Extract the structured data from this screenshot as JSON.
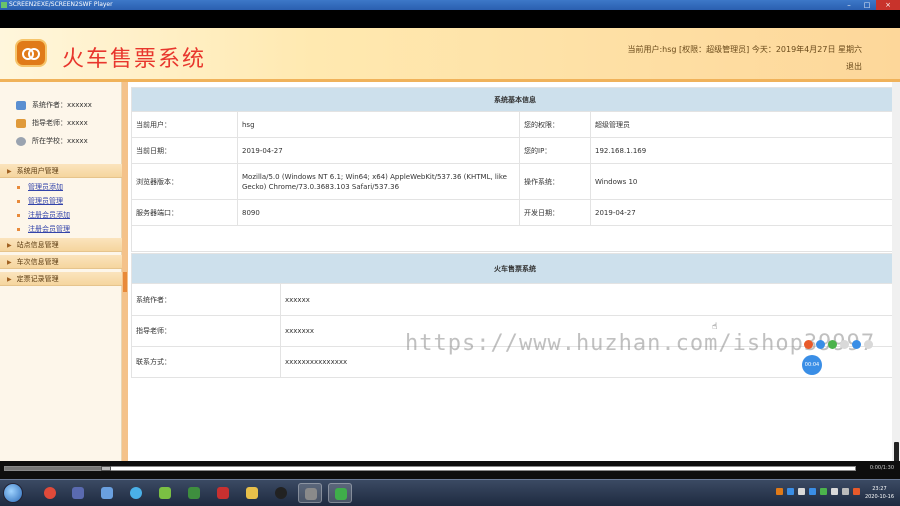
{
  "window": {
    "title": "SCREEN2EXE/SCREEN2SWF Player"
  },
  "header": {
    "system_title": "火车售票系统",
    "user_info": "当前用户:hsg [权限：超级管理员] 今天：2019年4月27日 星期六",
    "logout": "退出"
  },
  "sidebar": {
    "info": [
      {
        "label": "系统作者：xxxxxx"
      },
      {
        "label": "指导老师：xxxxx"
      },
      {
        "label": "所在学校：xxxxx"
      }
    ],
    "groups": [
      {
        "label": "系统用户管理",
        "items": [
          "管理员添加",
          "管理员管理",
          "注册会员添加",
          "注册会员管理"
        ]
      },
      {
        "label": "站点信息管理"
      },
      {
        "label": "车次信息管理"
      },
      {
        "label": "定票记录管理"
      }
    ]
  },
  "basic_info": {
    "header": "系统基本信息",
    "rows": [
      {
        "k1": "当前用户：",
        "v1": "hsg",
        "k2": "您的权限：",
        "v2": "超级管理员"
      },
      {
        "k1": "当前日期：",
        "v1": "2019-04-27",
        "k2": "您的IP：",
        "v2": "192.168.1.169"
      },
      {
        "k1": "浏览器版本：",
        "v1": "Mozilla/5.0 (Windows NT 6.1; Win64; x64) AppleWebKit/537.36 (KHTML, like Gecko) Chrome/73.0.3683.103 Safari/537.36",
        "k2": "操作系统：",
        "v2": "Windows 10"
      },
      {
        "k1": "服务器端口：",
        "v1": "8090",
        "k2": "开发日期：",
        "v2": "2019-04-27"
      }
    ]
  },
  "about": {
    "header": "火车售票系统",
    "rows": [
      {
        "k": "系统作者：",
        "v": "xxxxxx"
      },
      {
        "k": "指导老师：",
        "v": "xxxxxxx"
      },
      {
        "k": "联系方式：",
        "v": "xxxxxxxxxxxxxxx"
      }
    ]
  },
  "overlay": {
    "watermark": "https://www.huzhan.com/ishop39997",
    "badge": "00:04"
  },
  "player": {
    "progress": 0.12,
    "time": "0:00/1:30"
  },
  "taskbar": {
    "time": "23:27",
    "date": "2020-10-16"
  },
  "colors": {
    "accent": "#e8362d",
    "table_header": "#cde0ec",
    "menu_bg": "#fbe4bd",
    "link": "#3344aa"
  }
}
